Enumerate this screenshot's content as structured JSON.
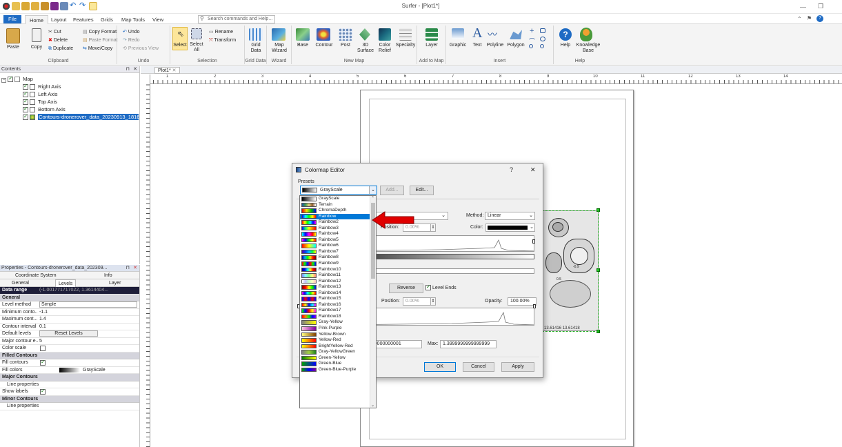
{
  "window": {
    "title": "Surfer - [Plot1*]"
  },
  "tabs": [
    {
      "label": "File"
    },
    {
      "label": "Home"
    },
    {
      "label": "Layout"
    },
    {
      "label": "Features"
    },
    {
      "label": "Grids"
    },
    {
      "label": "Map Tools"
    },
    {
      "label": "View"
    }
  ],
  "search": {
    "placeholder": "Search commands and Help..."
  },
  "ribbon": {
    "clipboard": {
      "label": "Clipboard",
      "paste": "Paste",
      "copy": "Copy",
      "cut": "Cut",
      "delete": "Delete",
      "duplicate": "Duplicate",
      "copy_format": "Copy Format",
      "paste_format": "Paste Format",
      "move_copy": "Move/Copy"
    },
    "undo": {
      "label": "Undo",
      "undo": "Undo",
      "redo": "Redo",
      "previous_view": "Previous View"
    },
    "selection": {
      "label": "Selection",
      "select": "Select",
      "select_all": "Select All",
      "rename": "Rename",
      "transform": "Transform"
    },
    "grid_data": {
      "label": "Grid Data",
      "grid_data": "Grid Data"
    },
    "wizard": {
      "label": "Wizard",
      "map_wizard": "Map Wizard"
    },
    "new_map": {
      "label": "New Map",
      "items": [
        "Base",
        "Contour",
        "Post",
        "3D Surface",
        "Color Relief",
        "Specialty"
      ]
    },
    "add_to_map": {
      "label": "Add to Map",
      "layer": "Layer"
    },
    "insert": {
      "label": "Insert",
      "items": [
        "Graphic",
        "Text",
        "Polyline",
        "Polygon"
      ]
    },
    "help": {
      "label": "Help",
      "help": "Help",
      "knowledge_base": "Knowledge Base"
    }
  },
  "contents": {
    "title": "Contents",
    "tree": [
      {
        "label": "Map"
      },
      {
        "label": "Right Axis"
      },
      {
        "label": "Left Axis"
      },
      {
        "label": "Top Axis"
      },
      {
        "label": "Bottom Axis"
      },
      {
        "label": "Contours-dronerover_data_20230913_1816"
      }
    ]
  },
  "properties": {
    "title": "Properties - Contours-dronerover_data_202309...",
    "tabs_row1": [
      "Coordinate System",
      "Info"
    ],
    "tabs_row2": [
      "General",
      "Levels",
      "Layer"
    ],
    "data_range": {
      "key": "Data range",
      "value": "(-1.001771717022, 1.3614404..."
    },
    "sections": {
      "general": "General",
      "filled": "Filled Contours",
      "major": "Major Contours",
      "minor": "Minor Contours"
    },
    "rows": {
      "level_method": {
        "k": "Level method",
        "v": "Simple"
      },
      "min": {
        "k": "Minimum conto...",
        "v": "-1.1"
      },
      "max": {
        "k": "Maximum cont...",
        "v": "1.4"
      },
      "interval": {
        "k": "Contour interval",
        "v": "0.1"
      },
      "default_levels": {
        "k": "Default levels",
        "v": "Reset Levels"
      },
      "major_every": {
        "k": "Major contour e...",
        "v": "5"
      },
      "color_scale": {
        "k": "Color scale"
      },
      "fill_contours": {
        "k": "Fill contours"
      },
      "fill_colors": {
        "k": "Fill colors",
        "v": "GrayScale"
      },
      "line_props": {
        "k": "Line properties"
      },
      "show_labels": {
        "k": "Show labels"
      },
      "line_props2": {
        "k": "Line properties"
      }
    }
  },
  "doc_tab": {
    "label": "Plot1*"
  },
  "ruler": {
    "labels": [
      "1",
      "2",
      "3",
      "4",
      "5",
      "6",
      "7",
      "8",
      "9",
      "10",
      "11",
      "12",
      "13",
      "14"
    ]
  },
  "map_labels": {
    "axis": "13.61416  13.61418",
    "contour_a": "-0.9",
    "contour_b": "0.5"
  },
  "dialog": {
    "title": "Colormap Editor",
    "presets_label": "Presets",
    "selected_preset": "GrayScale",
    "add": "Add...",
    "edit": "Edit...",
    "method_label": "Method:",
    "method_value": "Linear",
    "position_label": "Position:",
    "position_value": "0.00%",
    "color_label": "Color:",
    "reverse": "Reverse",
    "level_ends": "Level Ends",
    "position2_label": "Position:",
    "position2_value": "0.00%",
    "opacity_label": "Opacity:",
    "opacity_value": "100.00%",
    "min_value": "000000000001",
    "max_label": "Max:",
    "max_value": "1.3999999999999999",
    "ok": "OK",
    "cancel": "Cancel",
    "apply": "Apply",
    "help_btn": "?",
    "close_btn": "✕"
  },
  "presets": [
    {
      "name": "GrayScale",
      "colors": [
        "#000",
        "#fff"
      ]
    },
    {
      "name": "Terrain",
      "colors": [
        "#1f4fa0",
        "#3fa050",
        "#e8d080",
        "#8a5a2a",
        "#fff"
      ]
    },
    {
      "name": "ChromaDepth",
      "colors": [
        "#e00000",
        "#f0e000",
        "#00c000",
        "#0000e0"
      ]
    },
    {
      "name": "Rainbow",
      "colors": [
        "#0000ff",
        "#00ffff",
        "#00ff00",
        "#ffff00",
        "#ff0000"
      ]
    },
    {
      "name": "Rainbow2",
      "colors": [
        "#ff0000",
        "#ffff00",
        "#00ff00",
        "#00ffff",
        "#0000ff",
        "#ff00ff"
      ]
    },
    {
      "name": "Rainbow3",
      "colors": [
        "#0000ff",
        "#00ff80",
        "#ffff00",
        "#ff8000",
        "#ff0000"
      ]
    },
    {
      "name": "Rainbow4",
      "colors": [
        "#00ffff",
        "#0000ff",
        "#ff00ff",
        "#ff0000",
        "#ffff00"
      ]
    },
    {
      "name": "Rainbow5",
      "colors": [
        "#ff00ff",
        "#0000ff",
        "#00ff00",
        "#ffff00",
        "#ff0000"
      ]
    },
    {
      "name": "Rainbow6",
      "colors": [
        "#ff0000",
        "#ff8000",
        "#ffff00",
        "#80ff80",
        "#00ffff"
      ]
    },
    {
      "name": "Rainbow7",
      "colors": [
        "#6000a0",
        "#0040ff",
        "#00c0ff",
        "#00ff40",
        "#ffff00"
      ]
    },
    {
      "name": "Rainbow8",
      "colors": [
        "#0000a0",
        "#00a0ff",
        "#00ff00",
        "#ffe000",
        "#ff0000",
        "#800000"
      ]
    },
    {
      "name": "Rainbow9",
      "colors": [
        "#ff0000",
        "#00ff00",
        "#0000ff",
        "#ff0000",
        "#00ff00",
        "#0000ff"
      ]
    },
    {
      "name": "Rainbow10",
      "colors": [
        "#000080",
        "#0000ff",
        "#00ffff",
        "#ffff00",
        "#ff0000",
        "#800000"
      ]
    },
    {
      "name": "Rainbow11",
      "colors": [
        "#8080ff",
        "#80ffff",
        "#80ff80",
        "#ffff80",
        "#ff8080"
      ]
    },
    {
      "name": "Rainbow12",
      "colors": [
        "#ffffff",
        "#c0c0ff",
        "#c0ffc0",
        "#ffffc0",
        "#ffc0c0"
      ]
    },
    {
      "name": "Rainbow13",
      "colors": [
        "#800000",
        "#ff0000",
        "#ffff00",
        "#00ff00",
        "#0000ff"
      ]
    },
    {
      "name": "Rainbow14",
      "colors": [
        "#ff00ff",
        "#0000ff",
        "#00ffff",
        "#00ff00",
        "#ffff00",
        "#ff0000"
      ]
    },
    {
      "name": "Rainbow15",
      "colors": [
        "#0000ff",
        "#ff0000",
        "#0000ff",
        "#ff0000",
        "#0000ff"
      ]
    },
    {
      "name": "Rainbow16",
      "colors": [
        "#ff0000",
        "#ffff00",
        "#0000ff",
        "#00ffff",
        "#ff00ff"
      ]
    },
    {
      "name": "Rainbow17",
      "colors": [
        "#00ff00",
        "#0000ff",
        "#ff0000",
        "#ffff00",
        "#ff00ff"
      ]
    },
    {
      "name": "Rainbow18",
      "colors": [
        "#ff0000",
        "#ff8000",
        "#00ff00",
        "#0000ff",
        "#8000ff"
      ]
    },
    {
      "name": "Gray-Yellow",
      "colors": [
        "#808080",
        "#ffff00"
      ]
    },
    {
      "name": "Pink-Purple",
      "colors": [
        "#ffc0e0",
        "#8000a0"
      ]
    },
    {
      "name": "Yellow-Brown",
      "colors": [
        "#ffff80",
        "#804000"
      ]
    },
    {
      "name": "Yellow-Red",
      "colors": [
        "#ffff00",
        "#ff0000"
      ]
    },
    {
      "name": "BrightYellow-Red",
      "colors": [
        "#ffff00",
        "#ff8000",
        "#ff0000"
      ]
    },
    {
      "name": "Gray-YellowGreen",
      "colors": [
        "#808080",
        "#a0d040",
        "#208020"
      ]
    },
    {
      "name": "Green-Yellow",
      "colors": [
        "#008000",
        "#ffff00"
      ]
    },
    {
      "name": "Green-Blue",
      "colors": [
        "#00a000",
        "#0000ff"
      ]
    },
    {
      "name": "Green-Blue-Purple",
      "colors": [
        "#00a000",
        "#0000ff",
        "#8000a0"
      ]
    }
  ],
  "selected_preset_name": "Rainbow",
  "accent": "#0078d7",
  "arrow_color": "#e00000"
}
